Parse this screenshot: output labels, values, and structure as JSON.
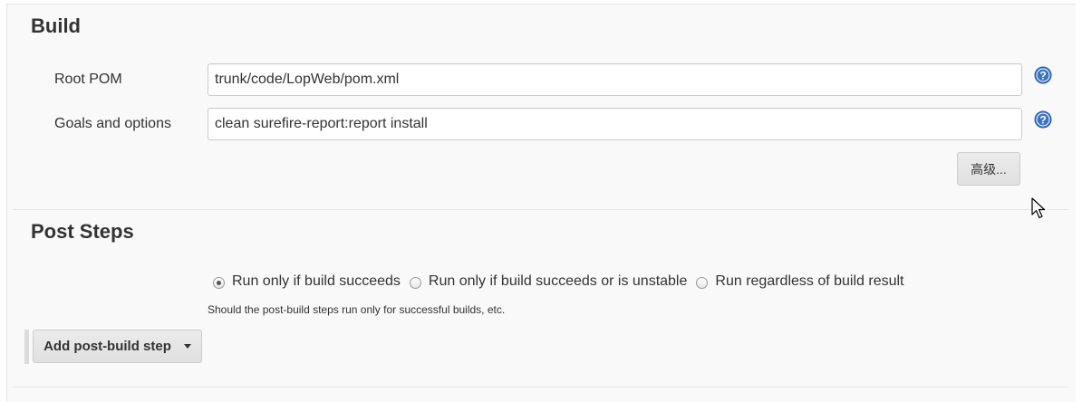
{
  "build": {
    "title": "Build",
    "root_pom": {
      "label": "Root POM",
      "value": "trunk/code/LopWeb/pom.xml"
    },
    "goals": {
      "label": "Goals and options",
      "value": "clean surefire-report:report install"
    },
    "advanced_button": "高级..."
  },
  "post_steps": {
    "title": "Post Steps",
    "options": [
      {
        "label": "Run only if build succeeds",
        "selected": true
      },
      {
        "label": "Run only if build succeeds or is unstable",
        "selected": false
      },
      {
        "label": "Run regardless of build result",
        "selected": false
      }
    ],
    "help_text": "Should the post-build steps run only for successful builds, etc.",
    "add_button": "Add post-build step"
  },
  "icons": {
    "help": "help-icon",
    "dropdown": "caret-down-icon",
    "cursor": "mouse-pointer-icon"
  },
  "colors": {
    "panel_bg": "#f9f9f9",
    "help_icon": "#3b74c2"
  }
}
